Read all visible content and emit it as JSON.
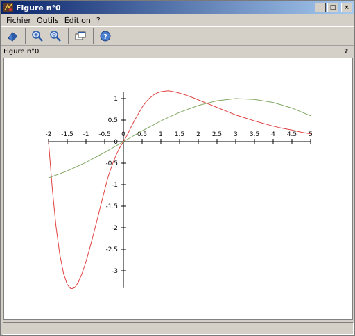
{
  "window": {
    "title": "Figure n°0",
    "minimize_label": "_",
    "maximize_label": "□",
    "close_label": "×"
  },
  "menu": {
    "items": [
      "Fichier",
      "Outils",
      "Édition",
      "?"
    ]
  },
  "toolbar": {
    "buttons": [
      "rotate-icon",
      "zoom-in-icon",
      "zoom-reset-icon",
      "new-window-icon",
      "help-icon"
    ]
  },
  "figure": {
    "label": "Figure n°0",
    "help": "?"
  },
  "colors": {
    "series_red": "#e04040",
    "series_green": "#80a860",
    "titlebar_start": "#0a246a",
    "titlebar_end": "#a6caf0"
  },
  "chart_data": {
    "type": "line",
    "title": "",
    "xlabel": "",
    "ylabel": "",
    "xlim": [
      -2,
      5
    ],
    "ylim": [
      -3.4,
      1.2
    ],
    "xticks": [
      -2,
      -1.5,
      -1,
      -0.5,
      0,
      0.5,
      1,
      1.5,
      2,
      2.5,
      3,
      3.5,
      4,
      4.5,
      5
    ],
    "xtick_labels": [
      "-2",
      "-1.5",
      "-1",
      "-0.5",
      "0",
      "0.5",
      "1",
      "1.5",
      "2",
      "2.5",
      "3",
      "3.5",
      "4",
      "4.5",
      "5"
    ],
    "yticks": [
      1,
      0.5,
      0,
      -0.5,
      -1,
      -1.5,
      -2,
      -2.5,
      -3
    ],
    "ytick_labels": [
      "1",
      "0.5",
      "0",
      "-0.5",
      "-1",
      "-1.5",
      "-2",
      "-2.5",
      "-3"
    ],
    "series": [
      {
        "color": "#e04040",
        "x": [
          -2.0,
          -1.9,
          -1.8,
          -1.7,
          -1.6,
          -1.5,
          -1.4,
          -1.3,
          -1.2,
          -1.1,
          -1.0,
          -0.9,
          -0.8,
          -0.7,
          -0.6,
          -0.5,
          -0.4,
          -0.3,
          -0.2,
          -0.1,
          0.0,
          0.1,
          0.2,
          0.3,
          0.4,
          0.5,
          0.6,
          0.7,
          0.8,
          0.9,
          1.0,
          1.2,
          1.4,
          1.6,
          1.8,
          2.0,
          2.2,
          2.4,
          2.6,
          2.8,
          3.0,
          3.25,
          3.5,
          3.75,
          4.0,
          4.25,
          4.5,
          4.75,
          5.0
        ],
        "y": [
          0.0,
          -1.09,
          -1.97,
          -2.62,
          -3.06,
          -3.32,
          -3.42,
          -3.39,
          -3.26,
          -3.05,
          -2.79,
          -2.48,
          -2.15,
          -1.81,
          -1.46,
          -1.12,
          -0.79,
          -0.54,
          -0.32,
          -0.14,
          0.0,
          0.15,
          0.33,
          0.5,
          0.65,
          0.8,
          0.92,
          1.01,
          1.08,
          1.13,
          1.16,
          1.18,
          1.15,
          1.1,
          1.04,
          0.97,
          0.9,
          0.83,
          0.76,
          0.69,
          0.62,
          0.55,
          0.48,
          0.42,
          0.36,
          0.31,
          0.27,
          0.22,
          0.18
        ]
      },
      {
        "color": "#80a860",
        "x": [
          -2.0,
          -1.5,
          -1.0,
          -0.5,
          0.0,
          0.5,
          1.0,
          1.5,
          2.0,
          2.5,
          3.0,
          3.5,
          4.0,
          4.5,
          5.0
        ],
        "y": [
          -0.84,
          -0.68,
          -0.48,
          -0.25,
          0.0,
          0.25,
          0.48,
          0.68,
          0.84,
          0.95,
          1.0,
          0.98,
          0.91,
          0.78,
          0.6
        ]
      }
    ]
  }
}
